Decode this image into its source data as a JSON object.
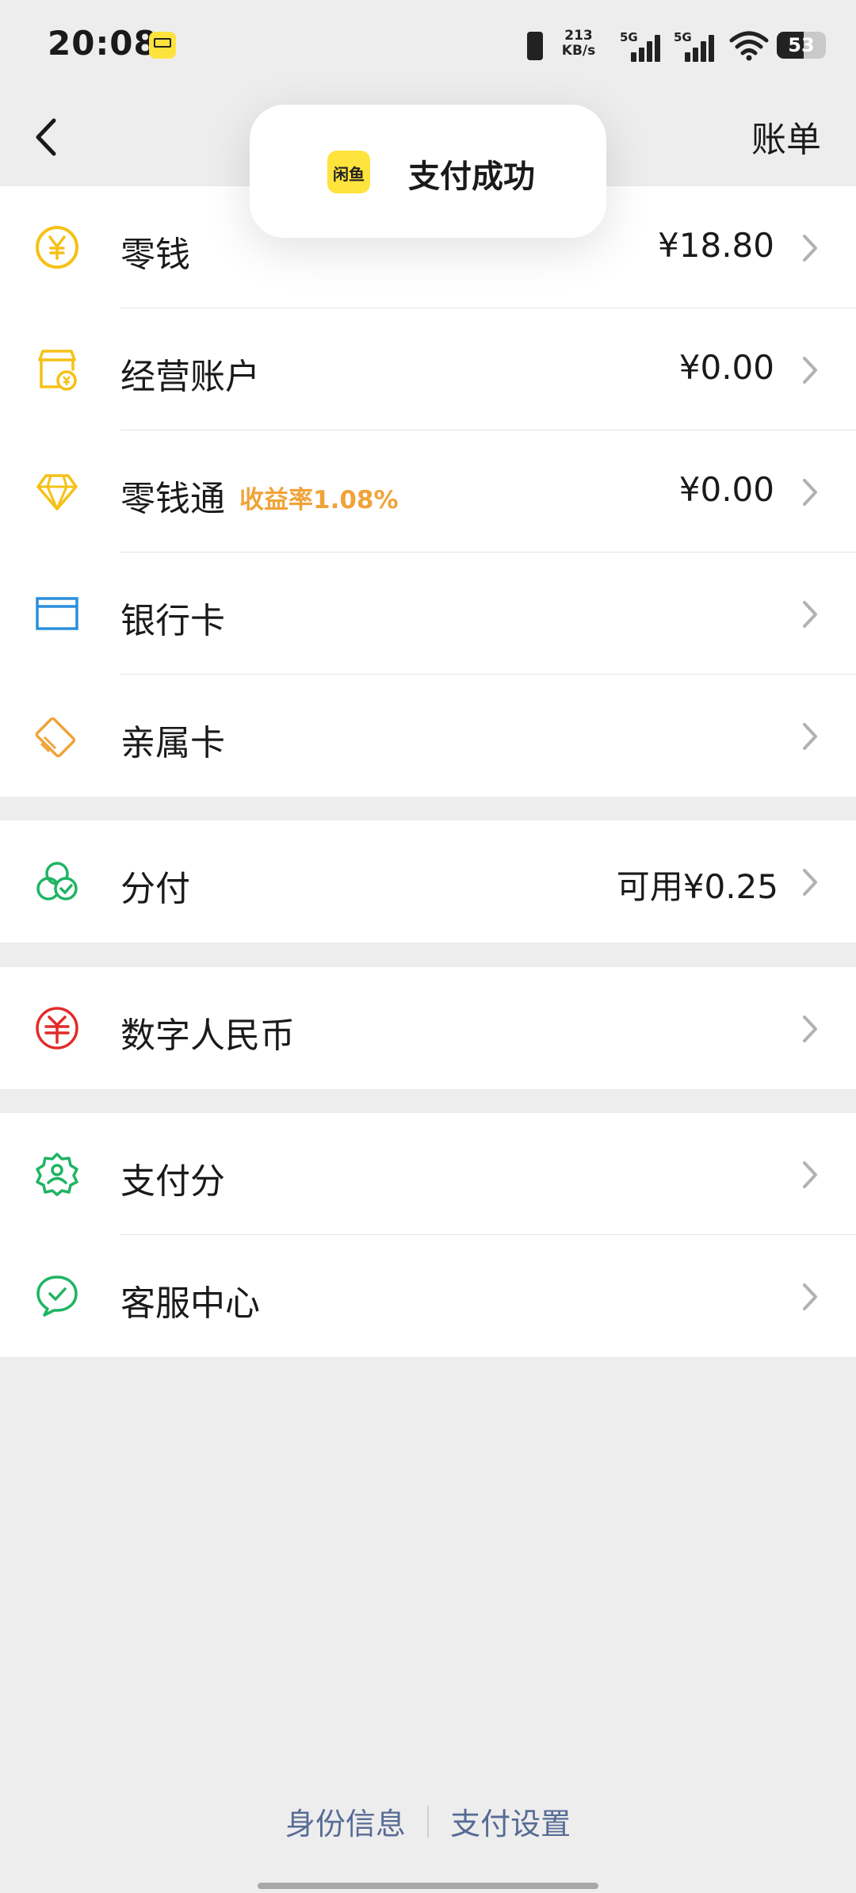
{
  "status_bar": {
    "time": "20:08",
    "net_speed_value": "213",
    "net_speed_unit": "KB/s",
    "signal_1": "5G",
    "signal_2": "5G",
    "battery": "53"
  },
  "nav": {
    "right_action": "账单"
  },
  "toast": {
    "app_name": "闲鱼",
    "message": "支付成功"
  },
  "wallet_items": [
    {
      "label": "零钱",
      "value": "¥18.80",
      "icon": "yuan-coin-icon",
      "color": "#f5c116"
    },
    {
      "label": "经营账户",
      "value": "¥0.00",
      "icon": "shop-account-icon",
      "color": "#f5c116"
    },
    {
      "label": "零钱通",
      "tag": "收益率1.08%",
      "value": "¥0.00",
      "icon": "diamond-icon",
      "color": "#f5c116"
    },
    {
      "label": "银行卡",
      "value": "",
      "icon": "bank-card-icon",
      "color": "#2b8fdc"
    },
    {
      "label": "亲属卡",
      "value": "",
      "icon": "family-card-icon",
      "color": "#f0a33a"
    }
  ],
  "credit_items": [
    {
      "label": "分付",
      "value": "可用¥0.25",
      "icon": "fenfu-icon",
      "color": "#1fb463"
    }
  ],
  "ecny_items": [
    {
      "label": "数字人民币",
      "value": "",
      "icon": "digital-rmb-icon",
      "color": "#e12b2b"
    }
  ],
  "service_items": [
    {
      "label": "支付分",
      "value": "",
      "icon": "pay-score-icon",
      "color": "#1fb463"
    },
    {
      "label": "客服中心",
      "value": "",
      "icon": "customer-service-icon",
      "color": "#1fb463"
    }
  ],
  "footer": {
    "identity_link": "身份信息",
    "settings_link": "支付设置"
  }
}
